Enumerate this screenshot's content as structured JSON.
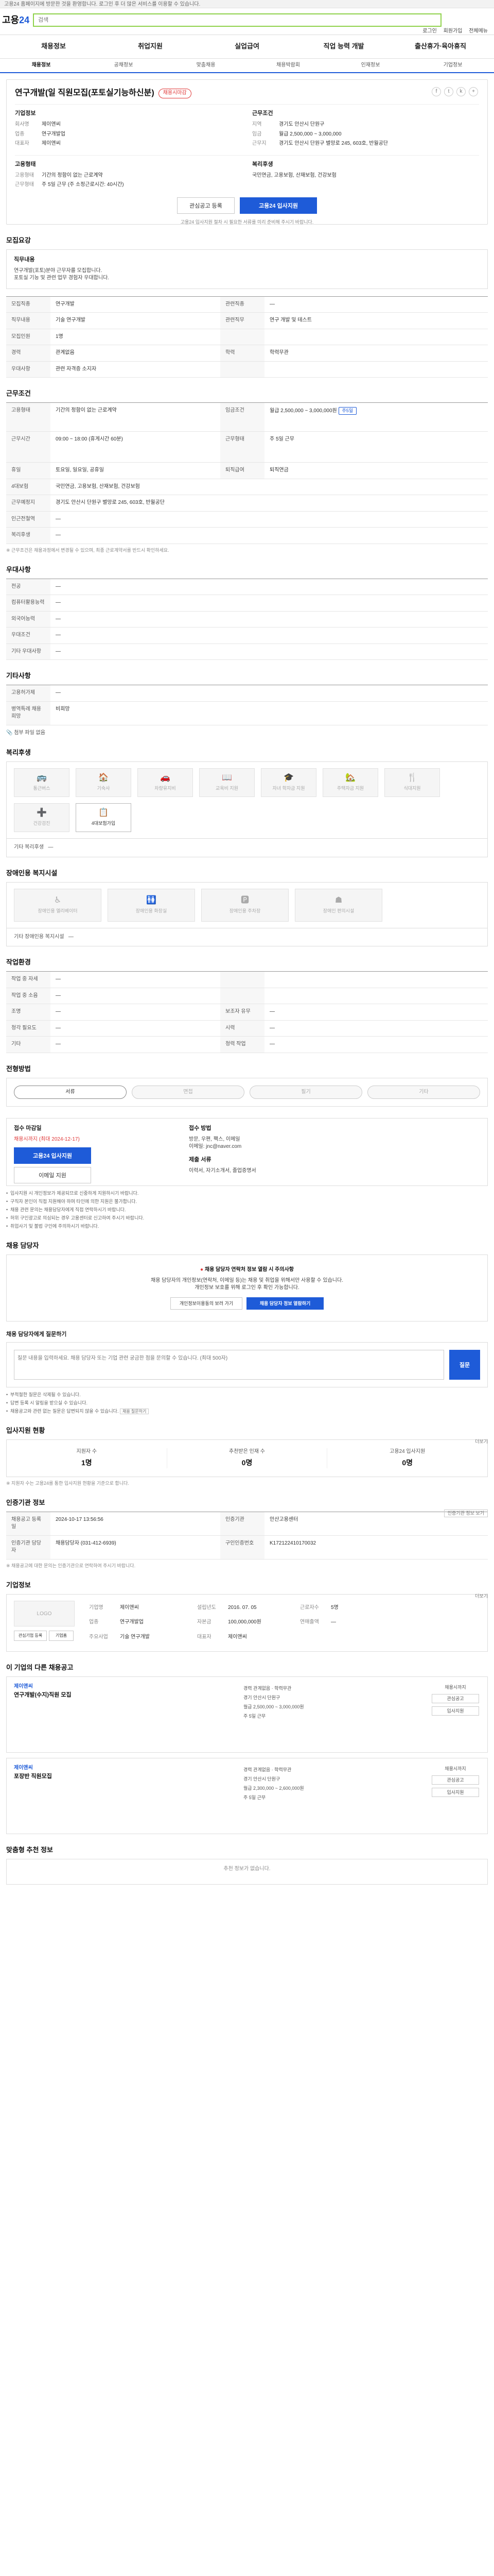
{
  "notice": {
    "text": "고용24 홈페이지에 방문한 것을 환영합니다. 로그인 후 더 많은 서비스를 이용할 수 있습니다."
  },
  "header": {
    "logo_main": "고용",
    "logo_num": "24",
    "search_placeholder": "검색",
    "links": [
      "로그인",
      "회원가입",
      "전체메뉴"
    ]
  },
  "gnb": [
    "채용정보",
    "취업지원",
    "실업급여",
    "직업 능력 개발",
    "출산휴가·육아휴직"
  ],
  "subtabs": [
    "채용정보",
    "공채정보",
    "맞춤채용",
    "채용박람회",
    "인재정보",
    "기업정보"
  ],
  "job": {
    "title": "연구개발(일 직원모집(포토실기능하신분)",
    "badge": "채용시마감",
    "share_icons": [
      "f",
      "t",
      "k",
      "+"
    ],
    "company": {
      "heading": "기업정보",
      "rows": [
        {
          "k": "회사명",
          "v": "제이앤씨"
        },
        {
          "k": "업종",
          "v": "연구개발업"
        },
        {
          "k": "대표자",
          "v": "제이앤씨"
        }
      ]
    },
    "condition": {
      "heading": "근무조건",
      "rows": [
        {
          "k": "지역",
          "v": "경기도 안산시 단원구"
        },
        {
          "k": "임금",
          "v": "월급 2,500,000 ~ 3,000,000"
        },
        {
          "k": "근무지",
          "v": "경기도 안산시 단원구 별망로 245, 603호, 반월공단"
        }
      ]
    },
    "qual": {
      "heading": "지원자격",
      "rows": [
        {
          "k": "경력",
          "v": "관계없음"
        },
        {
          "k": "학력",
          "v": "학력무관"
        }
      ]
    },
    "employ": {
      "heading": "고용형태",
      "rows": [
        {
          "k": "고용형태",
          "v": "기간의 정함이 없는 근로계약"
        },
        {
          "k": "근무형태",
          "v": "주 5일 근무 (주 소정근로시간: 40시간)"
        }
      ]
    },
    "welfare": {
      "heading": "복리후생",
      "rows": [
        {
          "k": "",
          "v": "국민연금, 고용보험, 산재보험, 건강보험"
        }
      ]
    },
    "btn_save": "관심공고 등록",
    "btn_apply": "고용24 입사지원",
    "note": "고용24 입사지원 절차 시 필요한 서류를 미리 준비해 주시기 바랍니다."
  },
  "summary": {
    "heading": "모집요강",
    "block_title": "직무내용",
    "lines": [
      "연구개발(포토)분야 근무자를 모집합니다.",
      "포토실 기능 및 관련 업무 경험자 우대합니다."
    ],
    "table": [
      {
        "k": "모집직종",
        "v": "연구개발",
        "k2": "관련직종",
        "v2": "—"
      },
      {
        "k": "직무내용",
        "v": "기술 연구개발",
        "k2": "관련직무",
        "v2": "연구 개발 및 테스트"
      },
      {
        "k": "모집인원",
        "v": "1명",
        "k2": "",
        "v2": ""
      },
      {
        "k": "경력",
        "v": "관계없음",
        "k2": "학력",
        "v2": "학력무관"
      },
      {
        "k": "우대사항",
        "v": "관련 자격증 소지자",
        "k2": "",
        "v2": ""
      }
    ]
  },
  "work": {
    "heading": "근무조건",
    "table": [
      {
        "k": "고용형태",
        "v": "기간의 정함이 없는 근로계약",
        "k2": "임금조건",
        "v2": "월급 2,500,000 ~ 3,000,000원"
      },
      {
        "k": "근무시간",
        "v": "09:00 ~ 18:00 (휴게시간 60분)",
        "k2": "근무형태",
        "v2": "주 5일 근무"
      },
      {
        "k": "휴일",
        "v": "토요일, 일요일, 공휴일",
        "k2": "퇴직급여",
        "v2": "퇴직연금"
      },
      {
        "k": "4대보험",
        "v": "국민연금, 고용보험, 산재보험, 건강보험",
        "k2": "",
        "v2": ""
      },
      {
        "k": "근무예정지",
        "v": "경기도 안산시 단원구 별망로 245, 603호, 반월공단",
        "k2": "",
        "v2": ""
      },
      {
        "k": "인근전철역",
        "v": "—",
        "k2": "",
        "v2": ""
      },
      {
        "k": "복리후생",
        "v": "—",
        "k2": "",
        "v2": ""
      }
    ],
    "tag": "주5일",
    "footnote": "※ 근무조건은 채용과정에서 변경될 수 있으며, 최종 근로계약서를 반드시 확인하세요."
  },
  "prefer": {
    "heading": "우대사항",
    "table": [
      {
        "k": "전공",
        "v": "—"
      },
      {
        "k": "컴퓨터활용능력",
        "v": "—"
      },
      {
        "k": "외국어능력",
        "v": "—"
      },
      {
        "k": "우대조건",
        "v": "—"
      },
      {
        "k": "기타 우대사항",
        "v": "—"
      }
    ]
  },
  "etc": {
    "heading": "기타사항",
    "table": [
      {
        "k": "고용허가제",
        "v": "—"
      },
      {
        "k": "병역특례 채용희망",
        "v": "비희망"
      }
    ],
    "attach": "첨부 파일 없음"
  },
  "benefits": {
    "heading": "복리후생",
    "items": [
      {
        "label": "통근버스",
        "icon": "🚌",
        "on": false
      },
      {
        "label": "기숙사",
        "icon": "🏠",
        "on": false
      },
      {
        "label": "차량유지비",
        "icon": "🚗",
        "on": false
      },
      {
        "label": "교육비 지원",
        "icon": "📖",
        "on": false
      },
      {
        "label": "자녀 학자금 지원",
        "icon": "🎓",
        "on": false
      },
      {
        "label": "주택자금 지원",
        "icon": "🏡",
        "on": false
      },
      {
        "label": "식대지원",
        "icon": "🍴",
        "on": false
      },
      {
        "label": "건강검진",
        "icon": "➕",
        "on": false
      },
      {
        "label": "4대보험가입",
        "icon": "📋",
        "on": true
      }
    ],
    "other_label": "기타 복리후생",
    "other_value": "—"
  },
  "disability": {
    "heading": "장애인용 복지시설",
    "items": [
      {
        "label": "장애인용 엘리베이터",
        "icon": "♿"
      },
      {
        "label": "장애인용 화장실",
        "icon": "🚻"
      },
      {
        "label": "장애인용 주차장",
        "icon": "🅿"
      },
      {
        "label": "장애인 편의시설",
        "icon": "☗"
      }
    ],
    "other_label": "기타 장애인용 복지시설",
    "other_value": "—"
  },
  "workenv": {
    "heading": "작업환경",
    "table": [
      {
        "k": "작업 중 자세",
        "v": "—",
        "k2": "",
        "v2": ""
      },
      {
        "k": "작업 중 소음",
        "v": "—",
        "k2": "",
        "v2": ""
      },
      {
        "k": "조명",
        "v": "—",
        "k2": "보조자 유무",
        "v2": "—"
      },
      {
        "k": "청각 필요도",
        "v": "—",
        "k2": "시력",
        "v2": "—"
      },
      {
        "k": "기타",
        "v": "—",
        "k2": "청력 작업",
        "v2": "—"
      }
    ]
  },
  "process": {
    "heading": "전형방법",
    "steps": [
      {
        "label": "서류",
        "on": true
      },
      {
        "label": "면접",
        "on": false
      },
      {
        "label": "필기",
        "on": false
      },
      {
        "label": "기타",
        "on": false
      }
    ]
  },
  "apply": {
    "left_title": "접수 마감일",
    "deadline": "채용시까지 (최대 2024-12-17)",
    "btn_apply": "고용24 입사지원",
    "btn_email": "이메일 지원",
    "right_title": "접수 방법",
    "methods": [
      "방문, 우편, 팩스, 이메일",
      "이메일: jnc@naver.com"
    ],
    "docs_title": "제출 서류",
    "docs": "이력서, 자기소개서, 졸업증명서",
    "bullets": [
      "입사지원 시 개인정보가 제공되므로 신중하게 지원하시기 바랍니다.",
      "구직자 본인이 직접 지원해야 하며 타인에 의한 지원은 불가합니다.",
      "채용 관련 문의는 채용담당자에게 직접 연락하시기 바랍니다.",
      "허위 구인광고로 의심되는 경우 고용센터로 신고하여 주시기 바랍니다.",
      "취업사기 및 불법 구인에 주의하시기 바랍니다."
    ]
  },
  "contact": {
    "heading": "채용 담당자",
    "warn": "채용 담당자 연락처 정보 열람 시 주의사항",
    "desc1": "채용 담당자의 개인정보(연락처, 이메일 등)는 채용 및 취업을 위해서만 사용할 수 있습니다.",
    "desc2": "개인정보 보호를 위해 로그인 후 확인 가능합니다.",
    "btn_personal": "개인정보이용동의 보러 가기",
    "btn_view": "채용 담당자 정보 열람하기"
  },
  "inquiry": {
    "heading": "채용 담당자에게 질문하기",
    "placeholder": "질문 내용을 입력하세요. 채용 담당자 또는 기업 관련 궁금한 점을 문의할 수 있습니다. (최대 500자)",
    "btn": "질문",
    "notes": [
      "부적절한 질문은 삭제될 수 있습니다.",
      "답변 등록 시 알림을 받으실 수 있습니다.",
      "채용공고와 관련 없는 질문은 답변되지 않을 수 있습니다."
    ],
    "link_text": "채용 질문하기"
  },
  "stats": {
    "heading": "입사지원 현황",
    "more": "더보기",
    "items": [
      {
        "label": "지원자 수",
        "value": "1명"
      },
      {
        "label": "추천받은 인재 수",
        "value": "0명"
      },
      {
        "label": "고용24 입사지원",
        "value": "0명"
      }
    ],
    "note": "※ 지원자 수는 고용24를 통한 입사지원 현황을 기준으로 합니다."
  },
  "regist": {
    "heading": "인증기관 정보",
    "btn": "인증기관 정보 보기",
    "table": [
      {
        "k": "채용공고 등록일",
        "v": "2024-10-17 13:56:56",
        "k2": "인증기관",
        "v2": "안산고용센터"
      },
      {
        "k": "인증기관 담당자",
        "v": "채용담당자 (031-412-6939)",
        "k2": "구인인증번호",
        "v2": "K172122410170032"
      }
    ],
    "note": "※ 채용공고에 대한 문의는 인증기관으로 연락하여 주시기 바랍니다."
  },
  "company_info": {
    "heading": "기업정보",
    "more": "더보기",
    "logo_text": "LOGO",
    "btn_like": "관심기업 등록",
    "btn_home": "기업홈",
    "rows": [
      {
        "k": "기업명",
        "v": "제이앤씨",
        "k2": "설립년도",
        "v2": "2016. 07. 05",
        "k3": "근로자수",
        "v3": "5명"
      },
      {
        "k": "업종",
        "v": "연구개발업",
        "k2": "자본금",
        "v2": "100,000,000원",
        "k3": "연매출액",
        "v3": "—"
      },
      {
        "k": "주요사업",
        "v": "기술 연구개발",
        "k2": "대표자",
        "v2": "제이앤씨",
        "k3": "",
        "v3": ""
      }
    ]
  },
  "similar": {
    "heading": "이 기업의 다른 채용공고",
    "items": [
      {
        "name": "제이앤씨",
        "title": "연구개발(수지)직원 모집",
        "rows": [
          "경력 관계없음 · 학력무관",
          "경기 안산시 단원구",
          "월급 2,500,000 ~ 3,000,000원",
          "주 5일 근무"
        ],
        "deadline": "채용시까지",
        "btns": [
          "관심공고",
          "입사지원"
        ]
      },
      {
        "name": "제이앤씨",
        "title": "포장반 직원모집",
        "rows": [
          "경력 관계없음 · 학력무관",
          "경기 안산시 단원구",
          "월급 2,300,000 ~ 2,600,000원",
          "주 5일 근무"
        ],
        "deadline": "채용시까지",
        "btns": [
          "관심공고",
          "입사지원"
        ]
      }
    ]
  },
  "recommend": {
    "heading": "맞춤형 추천 정보",
    "empty": "추천 정보가 없습니다."
  }
}
